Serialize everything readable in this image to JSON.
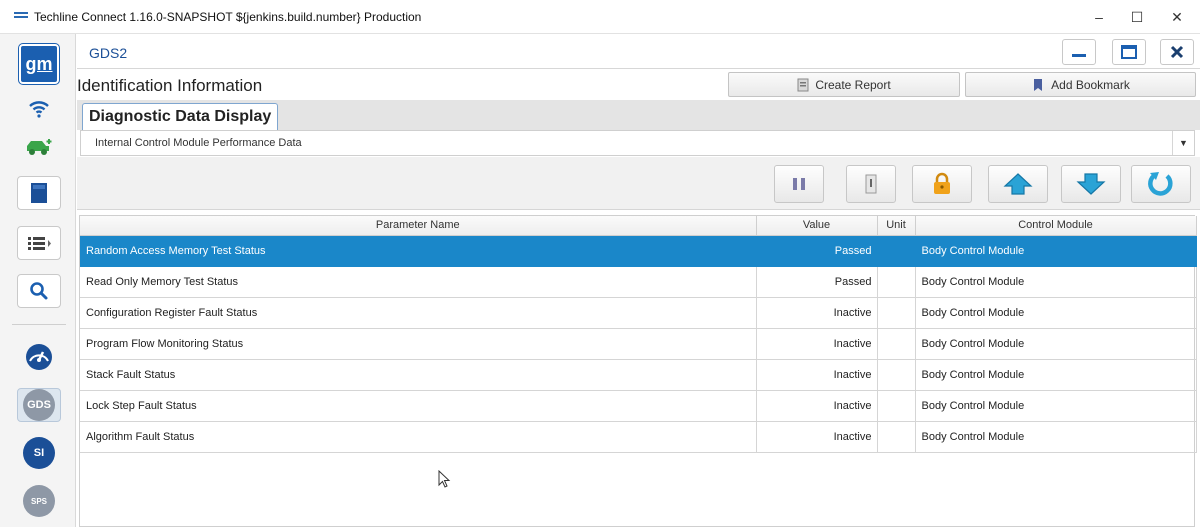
{
  "window": {
    "title": "Techline Connect 1.16.0-SNAPSHOT ${jenkins.build.number} Production",
    "controls": [
      "–",
      "☐",
      "✕"
    ]
  },
  "sidebar": {
    "logo": "gm",
    "gds_label": "GDS",
    "si_label": "SI",
    "sps_label": "SPS"
  },
  "app": {
    "name": "GDS2",
    "section_title": "Identification Information",
    "create_report": "Create Report",
    "add_bookmark": "Add Bookmark",
    "tab": "Diagnostic Data Display",
    "dropdown_value": "Internal Control Module Performance Data"
  },
  "table": {
    "headers": [
      "Parameter Name",
      "Value",
      "Unit",
      "Control Module"
    ],
    "rows": [
      {
        "name": "Random Access Memory Test Status",
        "value": "Passed",
        "unit": "",
        "module": "Body Control Module"
      },
      {
        "name": "Read Only Memory Test Status",
        "value": "Passed",
        "unit": "",
        "module": "Body Control Module"
      },
      {
        "name": "Configuration Register Fault Status",
        "value": "Inactive",
        "unit": "",
        "module": "Body Control Module"
      },
      {
        "name": "Program Flow Monitoring Status",
        "value": "Inactive",
        "unit": "",
        "module": "Body Control Module"
      },
      {
        "name": "Stack Fault Status",
        "value": "Inactive",
        "unit": "",
        "module": "Body Control Module"
      },
      {
        "name": "Lock Step Fault Status",
        "value": "Inactive",
        "unit": "",
        "module": "Body Control Module"
      },
      {
        "name": "Algorithm Fault Status",
        "value": "Inactive",
        "unit": "",
        "module": "Body Control Module"
      }
    ]
  },
  "colors": {
    "brand_blue": "#1b5fb0",
    "selection": "#1a87c9",
    "arrow_teal": "#2aa3d6",
    "lock_orange": "#f0a21a"
  }
}
